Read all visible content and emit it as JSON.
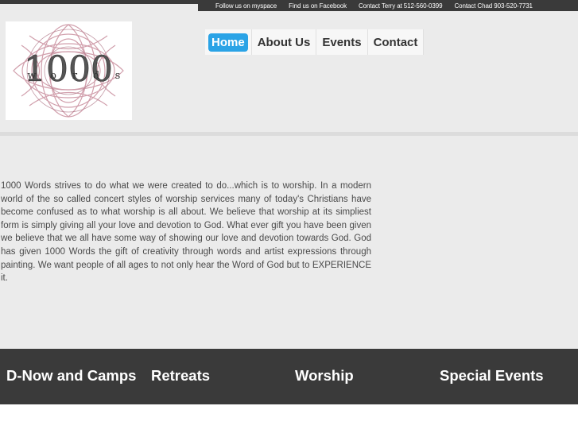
{
  "topbar": {
    "links": [
      "Follow us on myspace",
      "Find us on Facebook",
      "Contact Terry at 512-560-0399",
      "Contact Chad 903-520-7731"
    ]
  },
  "logo": {
    "number_text": "1000",
    "word_letters": [
      "w",
      "o",
      "r",
      "d",
      "s"
    ],
    "accent_color": "#c98f9e"
  },
  "nav": {
    "items": [
      "Home",
      "About Us",
      "Events",
      "Contact"
    ],
    "active": "Home",
    "active_color": "#2aa3e6"
  },
  "main": {
    "paragraph": "1000 Words strives to do what we were created to do...which is to worship. In a modern world of the so called concert styles of worship services many of today's Christians have become confused as to what worship is all about. We believe that worship at its simpliest form is simply giving all your love and devotion to God. What ever gift you have been given we believe that we all have some way of showing our love and devotion towards God. God has given 1000 Words the gift of creativity through words and artist expressions through painting. We want people of all ages to not only hear the Word of God but to EXPERIENCE it."
  },
  "footer": {
    "columns": [
      "D-Now and Camps",
      "Retreats",
      "Worship",
      "Special Events"
    ]
  }
}
